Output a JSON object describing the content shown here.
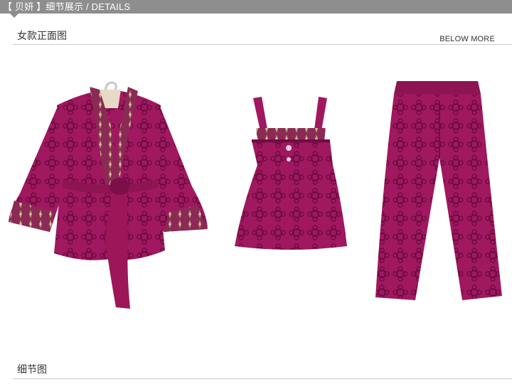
{
  "header": {
    "label": "【 贝妍 】细节展示 / DETAILS"
  },
  "section1": {
    "title": "女款正面图",
    "more": "BELOW MORE"
  },
  "section2": {
    "title": "细节图"
  },
  "colors": {
    "header_bg": "#8e8e8e",
    "fabric": "#a0185f",
    "fabric_dark": "#6f0d41",
    "fabric_light": "#c02a77",
    "trim": "#b79a78"
  },
  "garments": [
    "robe",
    "camisole",
    "pants"
  ]
}
